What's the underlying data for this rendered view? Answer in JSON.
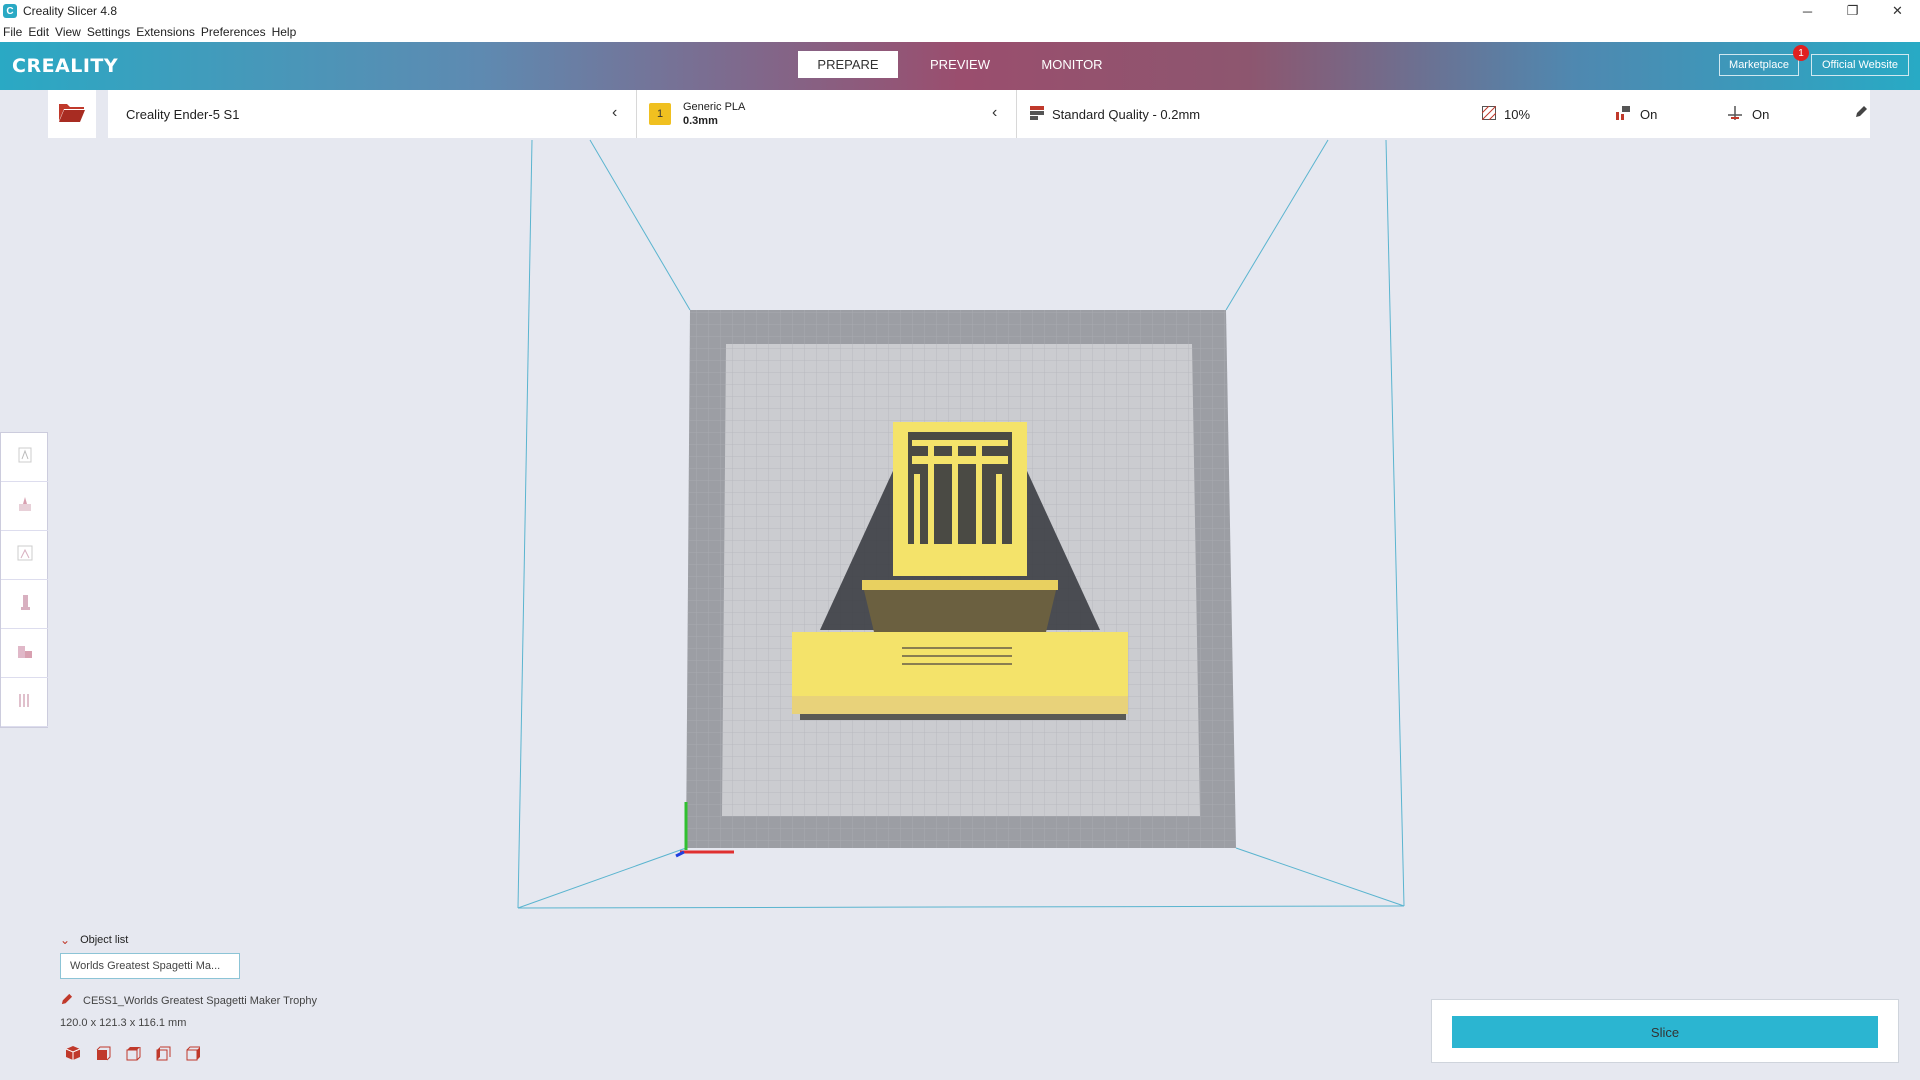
{
  "window": {
    "title": "Creality Slicer 4.8",
    "icon_letter": "C",
    "minimize": "─",
    "restore": "❐",
    "close": "✕"
  },
  "menu": [
    "File",
    "Edit",
    "View",
    "Settings",
    "Extensions",
    "Preferences",
    "Help"
  ],
  "header": {
    "logo": "CREALITY",
    "tabs": [
      "PREPARE",
      "PREVIEW",
      "MONITOR"
    ],
    "active_tab": "PREPARE",
    "marketplace": "Marketplace",
    "marketplace_badge": "1",
    "official_website": "Official Website"
  },
  "settings": {
    "printer": "Creality Ender-5 S1",
    "material_badge": "1",
    "material_name": "Generic PLA",
    "material_size": "0.3mm",
    "quality": "Standard Quality - 0.2mm",
    "infill": "10%",
    "support": "On",
    "adhesion": "On"
  },
  "left_tools": [
    "move-tool-icon",
    "scale-tool-icon",
    "rotate-tool-icon",
    "mirror-tool-icon",
    "per-model-settings-icon",
    "support-blocker-icon"
  ],
  "object_list": {
    "header": "Object list",
    "item": "Worlds Greatest Spagetti Ma...",
    "full_name": "CE5S1_Worlds Greatest Spagetti Maker Trophy",
    "dimensions": "120.0 x 121.3 x 116.1 mm"
  },
  "slice": {
    "button_label": "Slice"
  },
  "colors": {
    "accent": "#2bb5d1",
    "model": "#f4e36a",
    "badge": "#e02020"
  }
}
